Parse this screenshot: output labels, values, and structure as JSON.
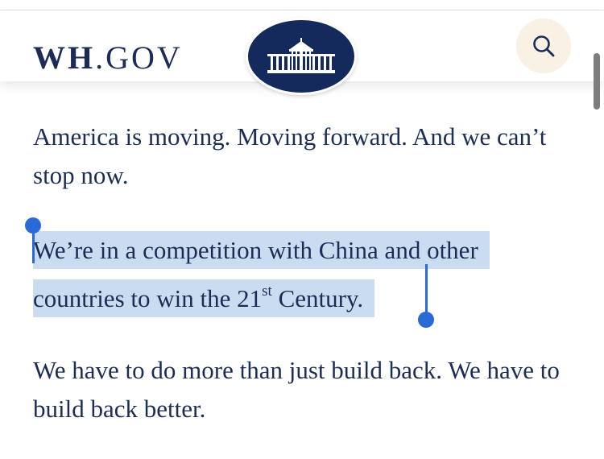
{
  "header": {
    "logo_bold": "WH",
    "logo_rest": ".GOV",
    "seal_icon": "white-house-seal-icon",
    "search_icon": "search-icon"
  },
  "content": {
    "paragraph_1": "America is moving. Moving forward. And we can’t stop now.",
    "paragraph_2": {
      "before_sup": "We’re in a competition with China and other countries to win the 21",
      "sup": "st",
      "after_sup": " Century."
    },
    "paragraph_3": "We have to do more than just build back. We have to build back better."
  },
  "selection": {
    "selected_text": "We’re in a competition with China and other countries to win the 21st Century."
  },
  "colors": {
    "text": "#1b2d57",
    "seal_bg": "#14295c",
    "search_bg": "#f8f1e4",
    "selection_highlight": "#c9dcf0",
    "selection_handle": "#2a6ad6"
  }
}
